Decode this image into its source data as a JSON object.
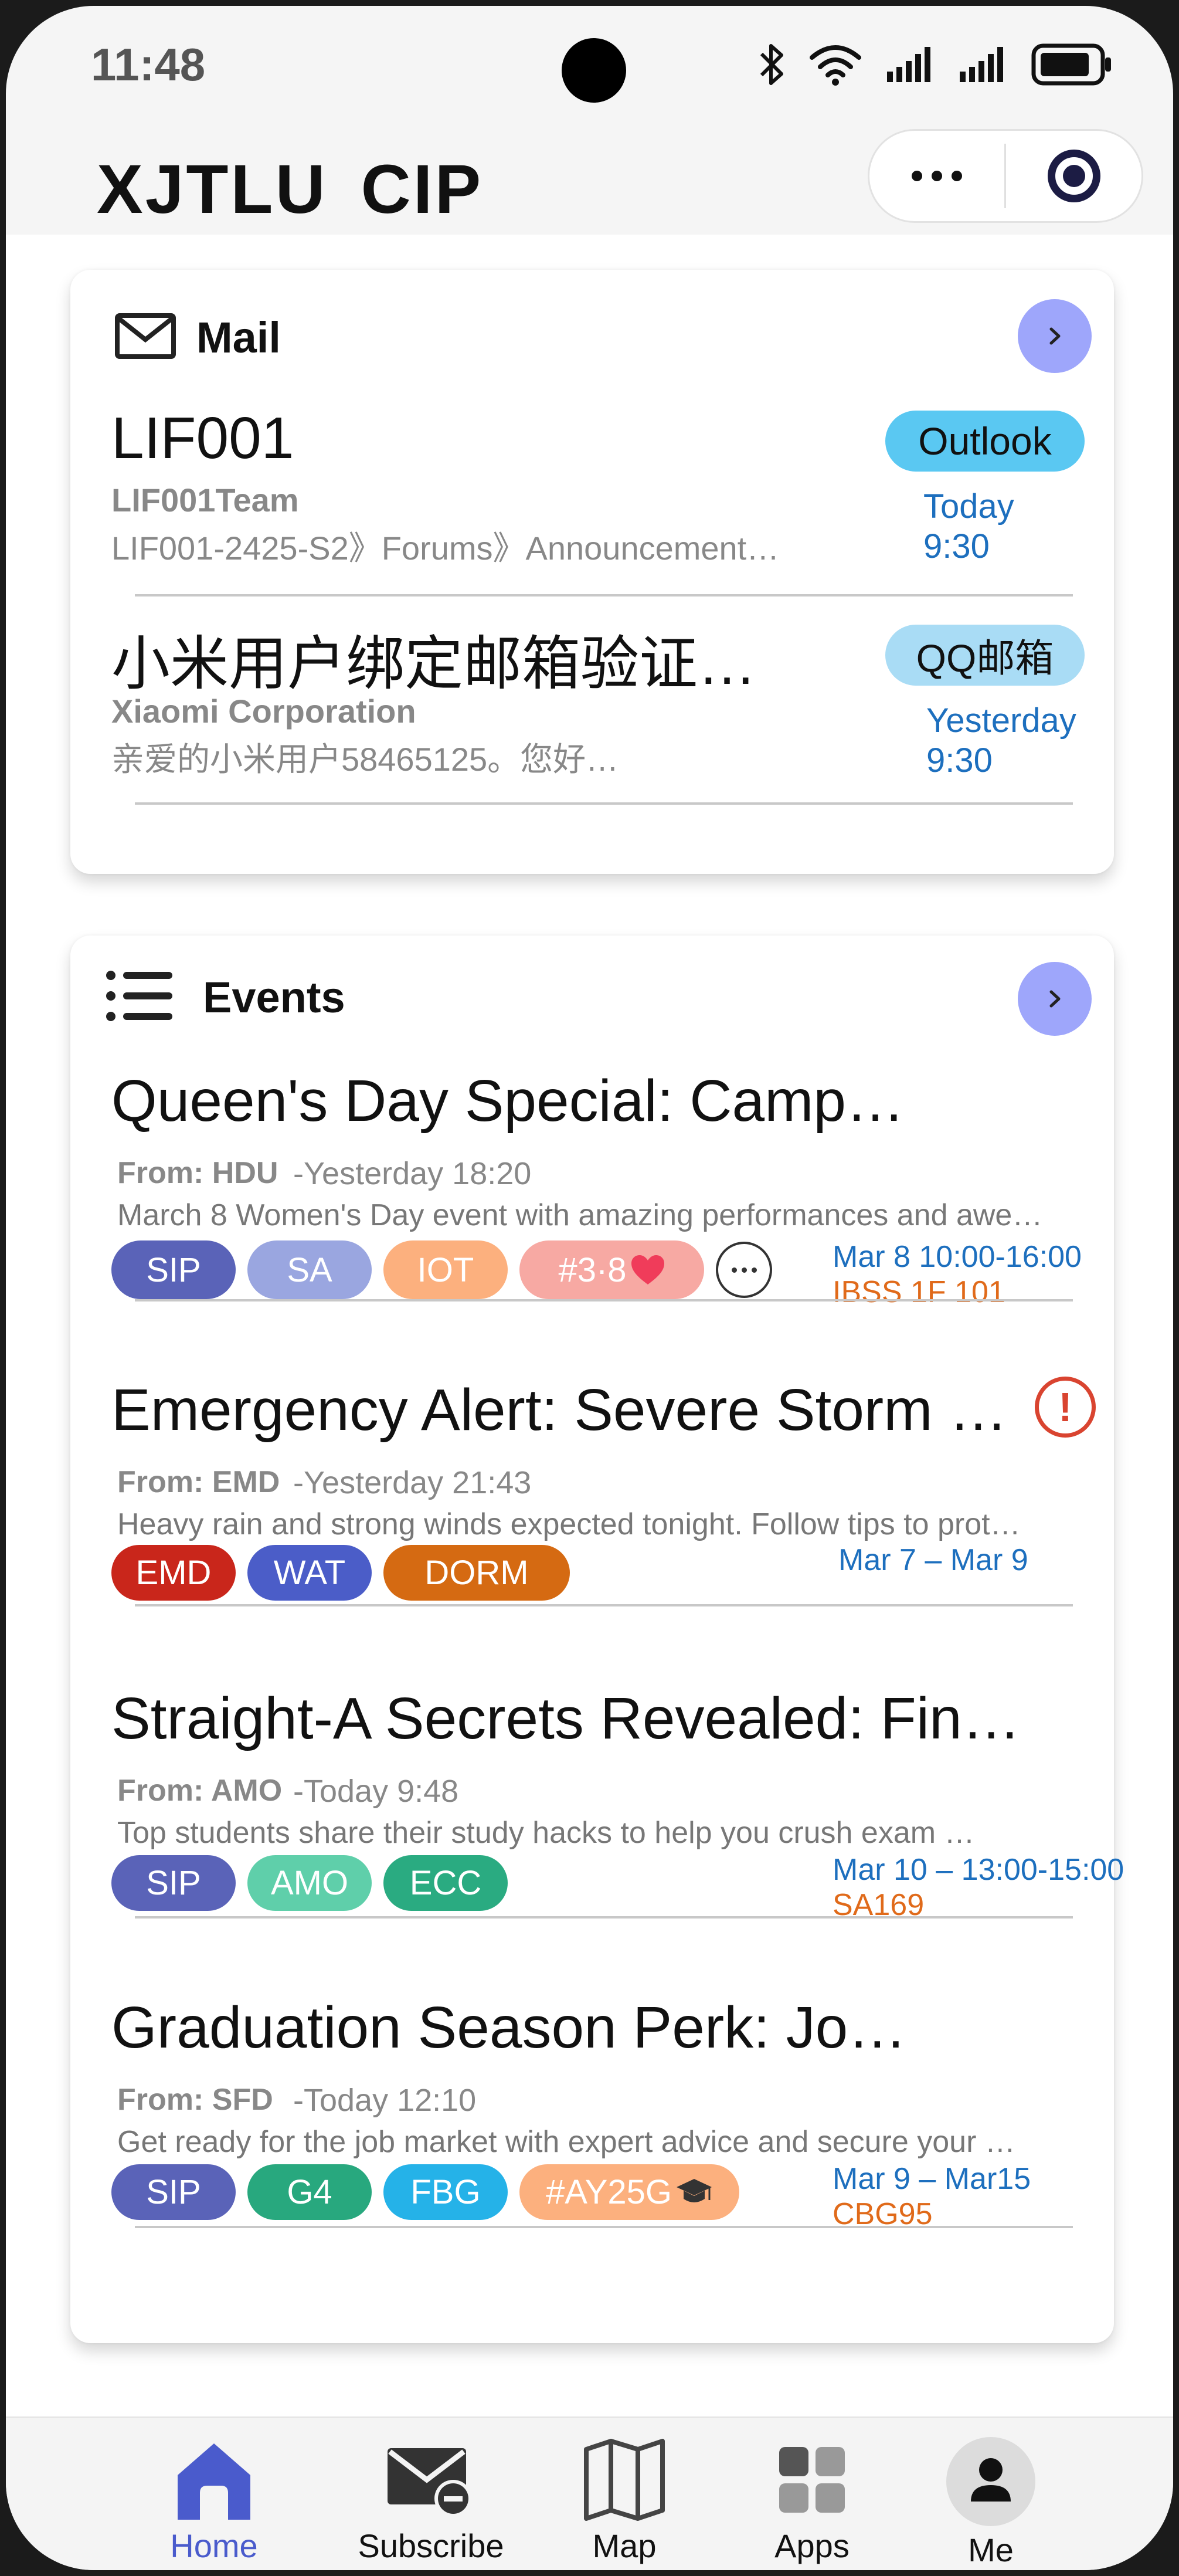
{
  "status_bar": {
    "time": "11:48"
  },
  "header": {
    "title": "XJTLU  CIP"
  },
  "mail": {
    "heading": "Mail",
    "items": [
      {
        "title": "LIF001",
        "sender": "LIF001Team",
        "snippet": "LIF001-2425-S2》Forums》Announcement…",
        "tag": "Outlook",
        "date": "Today",
        "time": "9:30"
      },
      {
        "title": "小米用户绑定邮箱验证…",
        "sender": "Xiaomi Corporation",
        "snippet": "亲爱的小米用户58465125。您好…",
        "tag": "QQ邮箱",
        "date": "Yesterday",
        "time": "9:30"
      }
    ]
  },
  "events": {
    "heading": "Events",
    "items": [
      {
        "title": "Queen's Day Special: Camp…",
        "from": "From: HDU",
        "time": "-Yesterday  18:20",
        "desc": "March 8 Women's Day event with amazing performances and awe…",
        "tags": [
          "SIP",
          "SA",
          "IOT",
          "#3·8"
        ],
        "when": "Mar 8 10:00-16:00",
        "where": "IBSS 1F 101"
      },
      {
        "title": "Emergency Alert: Severe Storm …",
        "from": "From: EMD",
        "time": "-Yesterday  21:43",
        "desc": "Heavy rain and strong winds expected tonight. Follow tips to prot…",
        "tags": [
          "EMD",
          "WAT",
          "DORM"
        ],
        "when": "Mar 7 – Mar 9",
        "alert": "!"
      },
      {
        "title": "Straight-A Secrets Revealed: Fin…",
        "from": "From: AMO",
        "time": "-Today  9:48",
        "desc": " Top students share their study hacks to help you crush exam …",
        "tags": [
          "SIP",
          "AMO",
          "ECC"
        ],
        "when": "Mar 10 – 13:00-15:00",
        "where": "SA169"
      },
      {
        "title": "Graduation Season Perk: Jo…",
        "from": "From: SFD",
        "time": "-Today  12:10",
        "desc": "Get ready for the job market with expert advice and secure your …",
        "tags": [
          "SIP",
          "G4",
          "FBG",
          "#AY25G"
        ],
        "when": "Mar 9 – Mar15",
        "where": "CBG95"
      }
    ]
  },
  "tabbar": {
    "items": [
      {
        "label": "Home",
        "icon": "home-icon",
        "active": true
      },
      {
        "label": "Subscribe",
        "icon": "mail-unsubscribe-icon"
      },
      {
        "label": "Map",
        "icon": "map-icon"
      },
      {
        "label": "Apps",
        "icon": "apps-grid-icon"
      },
      {
        "label": "Me",
        "icon": "user-icon"
      }
    ]
  },
  "colors": {
    "accent": "#4a5bcc",
    "go_button": "#9ea6fb",
    "outlook_tag": "#5ac8f2",
    "qq_tag": "#a9dcf5",
    "date_blue": "#1d6fbe",
    "location_orange": "#e06a1a",
    "alert_red": "#d94430",
    "tag_SIP": "#5a63b8",
    "tag_SA": "#9aa6e0",
    "tag_IOT": "#fcb07e",
    "tag_hash38": "#f7a9a3",
    "tag_EMD": "#c9261b",
    "tag_WAT": "#4b5dc8",
    "tag_DORM": "#d56a12",
    "tag_AMO": "#5fcfaa",
    "tag_ECC": "#2aab81",
    "tag_G4": "#28a87e",
    "tag_FBG": "#25b2e8",
    "tag_AY25G": "#fcb07e"
  }
}
